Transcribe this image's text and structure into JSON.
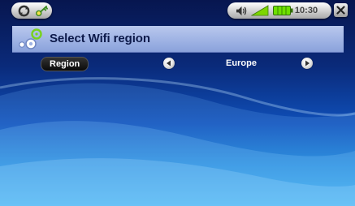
{
  "statusbar": {
    "left_icons": [
      "refresh-icon",
      "key-icon"
    ],
    "right_icons": [
      "speaker-icon",
      "signal-icon",
      "battery-icon"
    ],
    "clock": "10:30",
    "close_icon": "close-icon"
  },
  "header": {
    "icon": "gears-icon",
    "title": "Select Wifi region"
  },
  "setting": {
    "label": "Region",
    "value": "Europe",
    "prev_icon": "arrow-left-icon",
    "next_icon": "arrow-right-icon"
  },
  "colors": {
    "banner": "#a9bce8",
    "background_top": "#07164f",
    "background_bottom": "#3ab0ee",
    "signal_green": "#7dd600",
    "battery_green": "#6ee000"
  }
}
